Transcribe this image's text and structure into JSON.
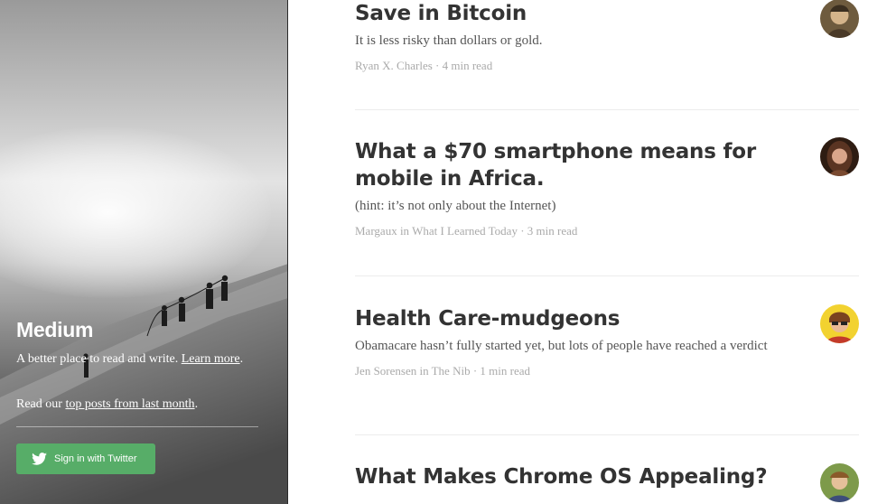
{
  "sidebar": {
    "brand": "Medium",
    "tagline_text": "A better place to read and write. ",
    "tagline_link": "Learn more",
    "tagline_end": ".",
    "top_prefix": "Read our ",
    "top_link": "top posts from last month",
    "top_end": ".",
    "twitter_button": "Sign in with Twitter",
    "colors": {
      "button": "#57ad68"
    }
  },
  "posts": [
    {
      "title": "Save in Bitcoin",
      "subtitle": "It is less risky than dollars or gold.",
      "meta": "Ryan X. Charles · 4 min read",
      "avatar": "avatar-ryan"
    },
    {
      "title": "What a $70 smartphone means for mobile in Africa.",
      "subtitle": "(hint: it’s not only about the Internet)",
      "meta": "Margaux in What I Learned Today · 3 min read",
      "avatar": "avatar-margaux"
    },
    {
      "title": "Health Care-mudgeons",
      "subtitle": "Obamacare hasn’t fully started yet, but lots of people have reached a verdict",
      "meta": "Jen Sorensen in The Nib  · 1 min read",
      "avatar": "avatar-jen"
    },
    {
      "title": "What Makes Chrome OS Appealing?",
      "subtitle": "",
      "meta": "",
      "avatar": "avatar-chrome-author"
    }
  ]
}
